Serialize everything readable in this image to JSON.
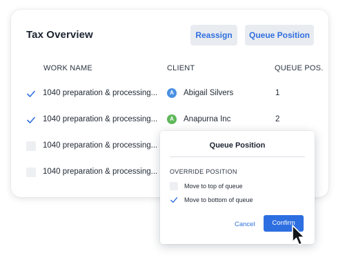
{
  "header": {
    "title": "Tax Overview",
    "reassign_label": "Reassign",
    "queue_position_label": "Queue Position"
  },
  "table": {
    "columns": [
      "WORK NAME",
      "CLIENT",
      "QUEUE POS."
    ],
    "rows": [
      {
        "checked": true,
        "work": "1040 preparation & processing...",
        "client": "Abigail Silvers",
        "initial": "A",
        "avatar_color": "#4a90e2",
        "queue": "1"
      },
      {
        "checked": true,
        "work": "1040 preparation & processing...",
        "client": "Anapurna Inc",
        "initial": "A",
        "avatar_color": "#5fb85a",
        "queue": "2"
      },
      {
        "checked": false,
        "work": "1040 preparation & processing...",
        "client": "",
        "initial": "",
        "avatar_color": "",
        "queue": ""
      },
      {
        "checked": false,
        "work": "1040 preparation & processing...",
        "client": "",
        "initial": "",
        "avatar_color": "",
        "queue": ""
      }
    ]
  },
  "popup": {
    "title": "Queue Position",
    "section_label": "OVERRIDE POSITION",
    "options": [
      {
        "label": "Move to top of queue",
        "checked": false
      },
      {
        "label": "Move to bottom of queue",
        "checked": true
      }
    ],
    "cancel_label": "Cancel",
    "confirm_label": "Confirm"
  },
  "colors": {
    "accent": "#2d6fe0",
    "soft_button_bg": "#e8ebf0"
  },
  "icons": {
    "check": "checkmark-icon",
    "cursor": "mouse-pointer-icon"
  }
}
